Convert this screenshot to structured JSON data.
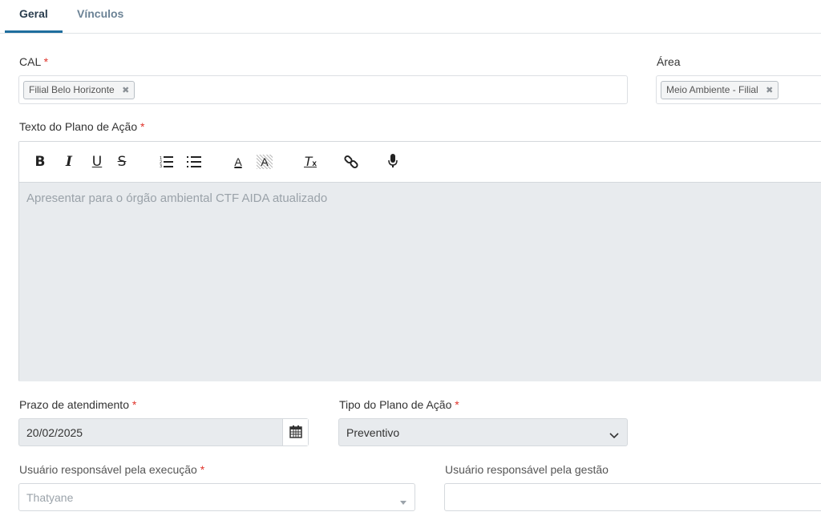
{
  "tabs": [
    {
      "label": "Geral",
      "active": true
    },
    {
      "label": "Vínculos",
      "active": false
    }
  ],
  "cal": {
    "label": "CAL",
    "required_mark": "*",
    "chip": "Filial Belo Horizonte",
    "chip_remove": "✖"
  },
  "area": {
    "label": "Área",
    "chip": "Meio Ambiente - Filial",
    "chip_remove": "✖"
  },
  "texto": {
    "label": "Texto do Plano de Ação",
    "required_mark": "*",
    "toolbar": {
      "bold": "B",
      "italic": "I",
      "underline": "U",
      "strike": "S",
      "ordered_list": "ordered-list-icon",
      "bullet_list": "bullet-list-icon",
      "font_color": "A",
      "highlight": "A",
      "clear_format": "T",
      "link": "link-icon",
      "mic": "microphone-icon"
    },
    "content": "Apresentar para o órgão ambiental CTF AIDA atualizado"
  },
  "prazo": {
    "label": "Prazo de atendimento",
    "required_mark": "*",
    "value": "20/02/2025"
  },
  "tipo": {
    "label": "Tipo do Plano de Ação",
    "required_mark": "*",
    "value": "Preventivo"
  },
  "usuario_exec": {
    "label": "Usuário responsável pela execução",
    "required_mark": "*",
    "value": "Thatyane"
  },
  "usuario_gestao": {
    "label": "Usuário responsável pela gestão",
    "value": ""
  },
  "colors": {
    "accent": "#1f6e9e",
    "required": "#e0342b",
    "disabled_bg": "#e8ebee"
  }
}
